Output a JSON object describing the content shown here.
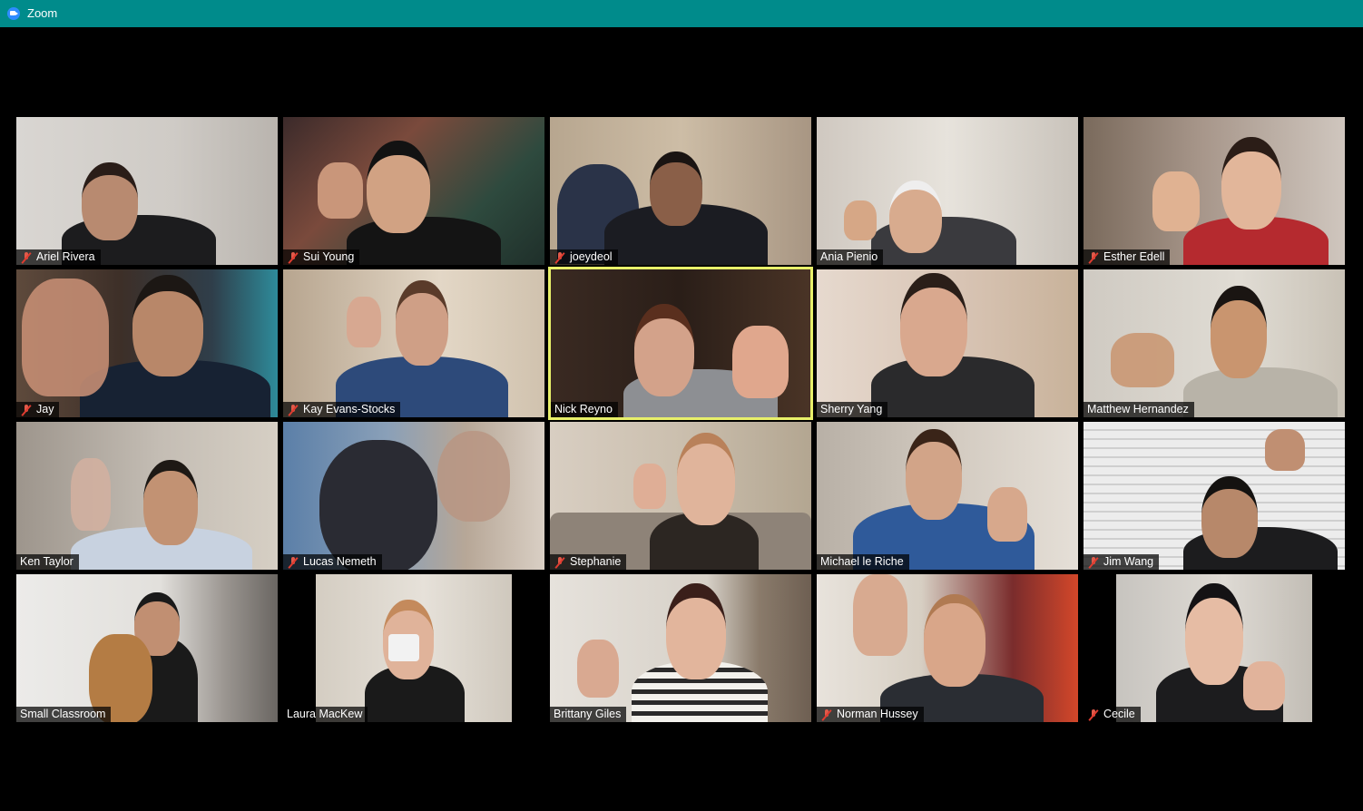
{
  "window": {
    "title": "Zoom"
  },
  "colors": {
    "titlebar": "#008b8b",
    "active_speaker_border": "#e8f06a",
    "muted_mic": "#e03c30"
  },
  "participants": [
    {
      "name": "Ariel Rivera",
      "muted": true
    },
    {
      "name": "Sui Young",
      "muted": true
    },
    {
      "name": "joeydeol",
      "muted": true
    },
    {
      "name": "Ania Pienio",
      "muted": false
    },
    {
      "name": "Esther Edell",
      "muted": true
    },
    {
      "name": "Jay",
      "muted": true
    },
    {
      "name": "Kay Evans-Stocks",
      "muted": true
    },
    {
      "name": "Nick Reyno",
      "muted": false,
      "active_speaker": true
    },
    {
      "name": "Sherry Yang",
      "muted": false
    },
    {
      "name": "Matthew Hernandez",
      "muted": false
    },
    {
      "name": "Ken Taylor",
      "muted": false
    },
    {
      "name": "Lucas Nemeth",
      "muted": true
    },
    {
      "name": "Stephanie",
      "muted": true
    },
    {
      "name": "Michael le Riche",
      "muted": false
    },
    {
      "name": "Jim Wang",
      "muted": true
    },
    {
      "name": "Small Classroom",
      "muted": false
    },
    {
      "name": "Laura MacKew",
      "muted": false
    },
    {
      "name": "Brittany Giles",
      "muted": false
    },
    {
      "name": "Norman Hussey",
      "muted": true
    },
    {
      "name": "Cecile",
      "muted": true
    }
  ]
}
